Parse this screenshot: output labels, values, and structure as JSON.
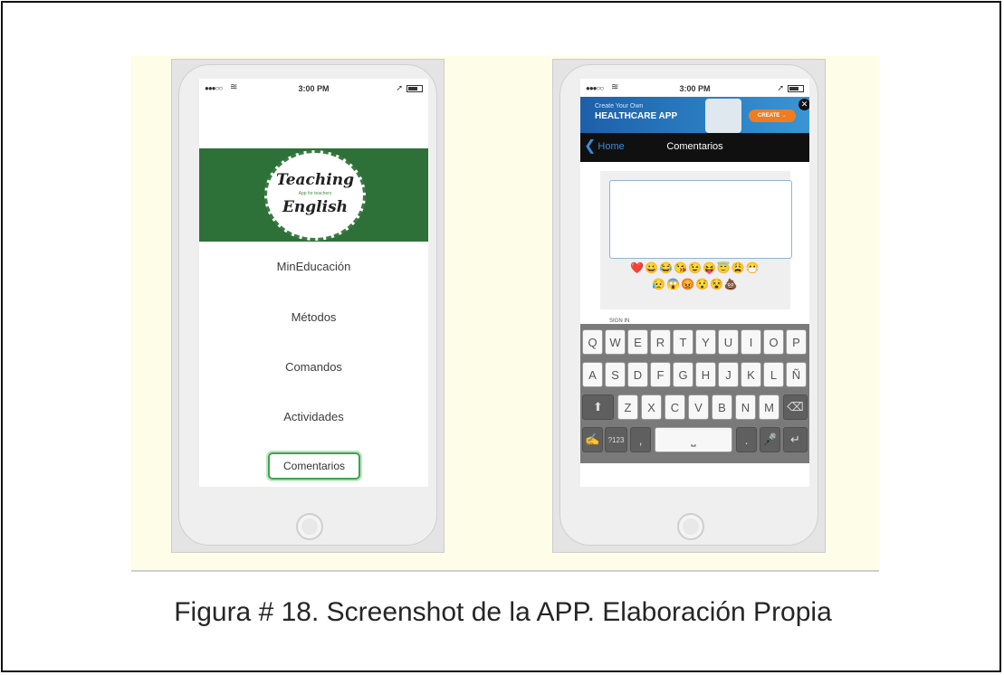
{
  "caption": "Figura # 18. Screenshot de la APP. Elaboración Propia",
  "status_bar": {
    "signal": "●●●○○",
    "time": "3:00 PM"
  },
  "left_screen": {
    "logo": {
      "title_line_1": "Teaching",
      "subtitle": "App for teachers",
      "title_line_2": "English"
    },
    "menu": [
      {
        "label": "MinEducación"
      },
      {
        "label": "Métodos"
      },
      {
        "label": "Comandos"
      },
      {
        "label": "Actividades"
      },
      {
        "label": "Comentarios",
        "selected": true
      }
    ]
  },
  "right_screen": {
    "ad": {
      "line_1": "Create Your Own",
      "line_2": "HEALTHCARE APP",
      "cta": "CREATE →",
      "close": "✕"
    },
    "nav": {
      "back_label": "Home",
      "title": "Comentarios"
    },
    "emoji_row_1": "❤️😀😂😘😉😝😇😩😷",
    "emoji_row_2": "😥😱😡😯😵💩",
    "sign_in": "SIGN IN",
    "keyboard": {
      "row_1": [
        "Q",
        "W",
        "E",
        "R",
        "T",
        "Y",
        "U",
        "I",
        "O",
        "P"
      ],
      "row_2": [
        "A",
        "S",
        "D",
        "F",
        "G",
        "H",
        "J",
        "K",
        "L",
        "Ñ"
      ],
      "row_3": [
        "Z",
        "X",
        "C",
        "V",
        "B",
        "N",
        "M"
      ],
      "symbols_key": "?123",
      "comma_key": ",",
      "period_key": ".",
      "space_key": "⎵"
    }
  },
  "colors": {
    "banner_green": "#2d7138",
    "selected_outline": "#3fa451",
    "nav_back_blue": "#3d8bd9",
    "ad_cta_orange": "#f07c22"
  }
}
